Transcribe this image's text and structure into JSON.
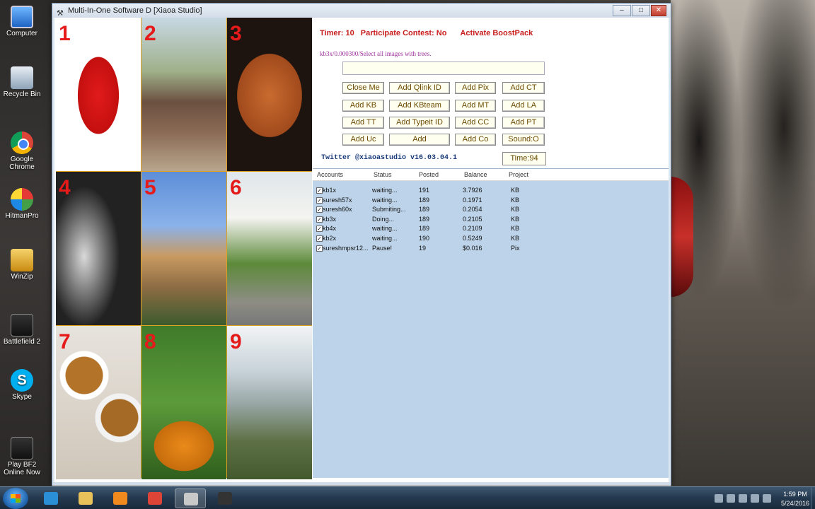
{
  "desktop": {
    "icons": [
      {
        "label": "Computer",
        "name": "computer-icon"
      },
      {
        "label": "Recycle Bin",
        "name": "recycle-bin-icon"
      },
      {
        "label": "Google Chrome",
        "name": "chrome-icon"
      },
      {
        "label": "HitmanPro",
        "name": "hitmanpro-icon"
      },
      {
        "label": "WinZip",
        "name": "winzip-icon"
      },
      {
        "label": "Battlefield 2",
        "name": "battlefield-icon"
      },
      {
        "label": "Skype",
        "name": "skype-icon"
      },
      {
        "label": "Play BF2 Online Now",
        "name": "battlefield-online-icon"
      }
    ]
  },
  "window": {
    "title": "Multi-In-One Software D [Xiaoa Studio]",
    "controls": {
      "minimize": "–",
      "maximize": "□",
      "close": "✕"
    }
  },
  "tiles": [
    {
      "number": "1",
      "subject": "chili peppers"
    },
    {
      "number": "2",
      "subject": "church and trees"
    },
    {
      "number": "3",
      "subject": "bean stew"
    },
    {
      "number": "4",
      "subject": "street lamps"
    },
    {
      "number": "5",
      "subject": "tower with trees"
    },
    {
      "number": "6",
      "subject": "church tower with trees"
    },
    {
      "number": "7",
      "subject": "buckwheat bowls"
    },
    {
      "number": "8",
      "subject": "pumpkin and leaves"
    },
    {
      "number": "9",
      "subject": "mountains"
    }
  ],
  "status": {
    "timer": "Timer: 10",
    "participate": "Participate Contest: No",
    "boost": "Activate BoostPack"
  },
  "instruction": "kb3x/0.000300/Select all images with trees.",
  "captcha_input": {
    "value": "",
    "placeholder": ""
  },
  "buttons": {
    "close_me": "Close Me",
    "add_qlink_id": "Add Qlink ID",
    "add_pix": "Add Pix",
    "add_ct": "Add CT",
    "add_kb": "Add KB",
    "add_kbteam": "Add KBteam",
    "add_mt": "Add MT",
    "add_la": "Add LA",
    "add_tt": "Add TT",
    "add_typeit_id": "Add Typeit ID",
    "add_cc": "Add CC",
    "add_pt": "Add PT",
    "add_uc": "Add Uc",
    "add": "Add",
    "add_co": "Add Co",
    "sound": "Sound:O"
  },
  "twitter": "Twitter @xiaoastudio v16.03.04.1",
  "time": "Time:94",
  "accounts": {
    "headers": {
      "accounts": "Accounts",
      "status": "Status",
      "posted": "Posted",
      "balance": "Balance",
      "project": "Project"
    },
    "rows": [
      {
        "checked": "✓",
        "account": "kb1x",
        "status": "waiting...",
        "posted": "191",
        "balance": "3.7926",
        "project": "KB"
      },
      {
        "checked": "✓",
        "account": "suresh57x",
        "status": "waiting...",
        "posted": "189",
        "balance": "0.1971",
        "project": "KB"
      },
      {
        "checked": "✓",
        "account": "suresh60x",
        "status": "Submiting...",
        "posted": "189",
        "balance": "0.2054",
        "project": "KB"
      },
      {
        "checked": "✓",
        "account": "kb3x",
        "status": "Doing...",
        "posted": "189",
        "balance": "0.2105",
        "project": "KB"
      },
      {
        "checked": "✓",
        "account": "kb4x",
        "status": "waiting...",
        "posted": "189",
        "balance": "0.2109",
        "project": "KB"
      },
      {
        "checked": "✓",
        "account": "kb2x",
        "status": "waiting...",
        "posted": "190",
        "balance": "0.5249",
        "project": "KB"
      },
      {
        "checked": "✓",
        "account": "sureshmpsr12...",
        "status": "Pause!",
        "posted": "19",
        "balance": "$0.016",
        "project": "Pix"
      }
    ]
  },
  "taskbar": {
    "items": [
      {
        "name": "ie-taskbar-icon",
        "color": "#2b8fd8"
      },
      {
        "name": "explorer-taskbar-icon",
        "color": "#e8c15a"
      },
      {
        "name": "media-player-taskbar-icon",
        "color": "#f08a1e"
      },
      {
        "name": "chrome-taskbar-icon",
        "color": "#db4437"
      },
      {
        "name": "tools-taskbar-icon",
        "color": "#c9c9c9"
      },
      {
        "name": "obs-taskbar-icon",
        "color": "#333333"
      }
    ],
    "clock_time": "1:59 PM",
    "clock_date": "5/24/2016"
  }
}
